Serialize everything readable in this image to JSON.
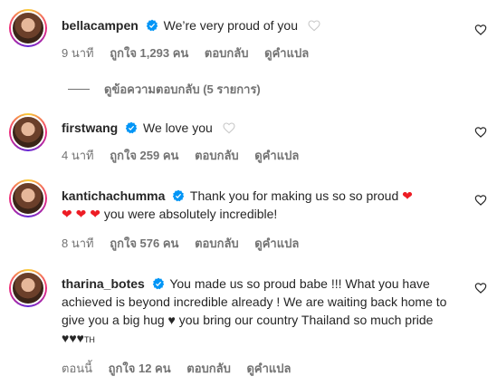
{
  "comments": [
    {
      "username": "bellacampen",
      "text": "We’re very proud of you",
      "time": "9 นาที",
      "likes": "ถูกใจ 1,293 คน",
      "reply": "ตอบกลับ",
      "translate": "ดูคำแปล"
    },
    {
      "username": "firstwang",
      "text": "We love you",
      "time": "4 นาที",
      "likes": "ถูกใจ 259 คน",
      "reply": "ตอบกลับ",
      "translate": "ดูคำแปล"
    },
    {
      "username": "kantichachumma",
      "text_part1": "Thank you for making us so so proud",
      "text_part2": "you were absolutely incredible!",
      "time": "8 นาที",
      "likes": "ถูกใจ 576 คน",
      "reply": "ตอบกลับ",
      "translate": "ดูคำแปล"
    },
    {
      "username": "tharina_botes",
      "text_part1": "You made us so proud babe !!! What you have achieved is beyond incredible already ! We are waiting back home to give you a big hug",
      "text_part2": "you bring our country Thailand so much pride",
      "flag": "TH",
      "time": "ตอนนี้",
      "likes": "ถูกใจ 12 คน",
      "reply": "ตอบกลับ",
      "translate": "ดูคำแปล"
    }
  ],
  "view_replies": "ดูข้อความตอบกลับ (5 รายการ)",
  "colors": {
    "verified": "#0095f6",
    "meta": "#737373",
    "heart": "#ed1c24"
  }
}
